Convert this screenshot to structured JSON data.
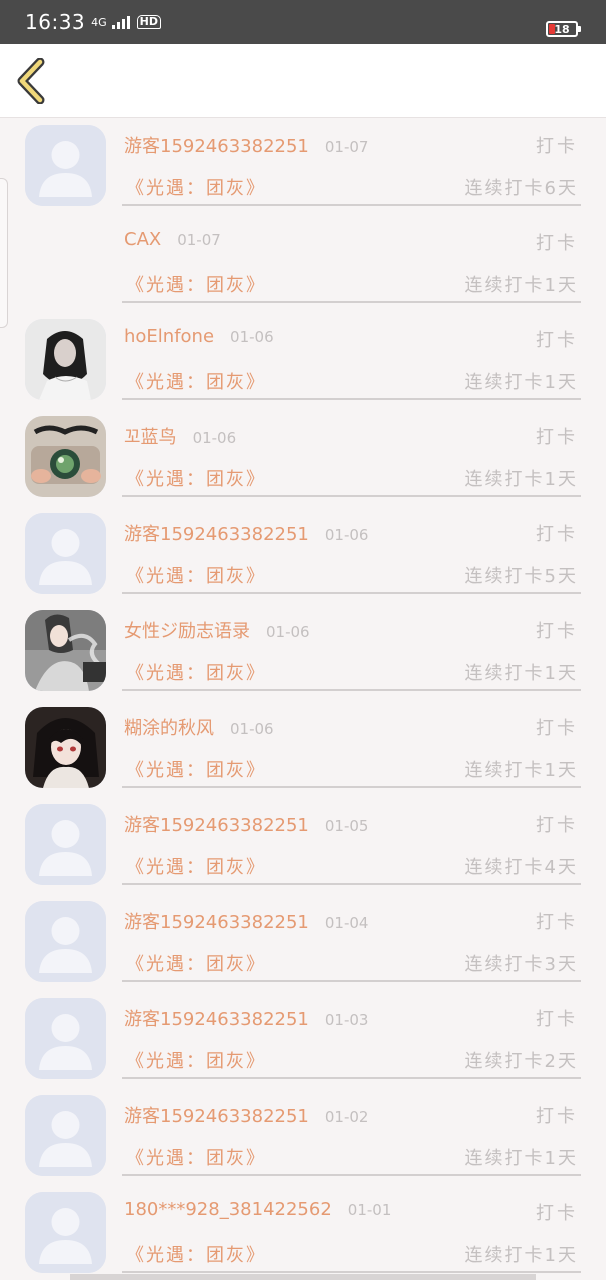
{
  "status_bar": {
    "time": "16:33",
    "network": "4G",
    "hd": "HD",
    "battery": "18"
  },
  "header": {
    "back_icon": "chevron-left-icon",
    "accent_color": "#f0d87a"
  },
  "colors": {
    "name": "#e59a72",
    "muted": "#c4c0c0",
    "divider": "#d3cfcf"
  },
  "entries": [
    {
      "name": "游客1592463382251",
      "date": "01-07",
      "action": "打卡",
      "title": "《光遇：团灰》",
      "streak": "连续打卡6天",
      "avatar": "default"
    },
    {
      "name": "CAX",
      "date": "01-07",
      "action": "打卡",
      "title": "《光遇：团灰》",
      "streak": "连续打卡1天",
      "avatar": "none"
    },
    {
      "name": "hoElnfone",
      "date": "01-06",
      "action": "打卡",
      "title": "《光遇：团灰》",
      "streak": "连续打卡1天",
      "avatar": "photo-girl"
    },
    {
      "name": "꼬蓝鸟",
      "date": "01-06",
      "action": "打卡",
      "title": "《光遇：团灰》",
      "streak": "连续打卡1天",
      "avatar": "photo-camera"
    },
    {
      "name": "游客1592463382251",
      "date": "01-06",
      "action": "打卡",
      "title": "《光遇：团灰》",
      "streak": "连续打卡5天",
      "avatar": "default"
    },
    {
      "name": "女性ジ励志语录",
      "date": "01-06",
      "action": "打卡",
      "title": "《光遇：团灰》",
      "streak": "连续打卡1天",
      "avatar": "photo-smoke"
    },
    {
      "name": "糊涂的秋风",
      "date": "01-06",
      "action": "打卡",
      "title": "《光遇：团灰》",
      "streak": "连续打卡1天",
      "avatar": "photo-anime"
    },
    {
      "name": "游客1592463382251",
      "date": "01-05",
      "action": "打卡",
      "title": "《光遇：团灰》",
      "streak": "连续打卡4天",
      "avatar": "default"
    },
    {
      "name": "游客1592463382251",
      "date": "01-04",
      "action": "打卡",
      "title": "《光遇：团灰》",
      "streak": "连续打卡3天",
      "avatar": "default"
    },
    {
      "name": "游客1592463382251",
      "date": "01-03",
      "action": "打卡",
      "title": "《光遇：团灰》",
      "streak": "连续打卡2天",
      "avatar": "default"
    },
    {
      "name": "游客1592463382251",
      "date": "01-02",
      "action": "打卡",
      "title": "《光遇：团灰》",
      "streak": "连续打卡1天",
      "avatar": "default"
    },
    {
      "name": "180***928_381422562",
      "date": "01-01",
      "action": "打卡",
      "title": "《光遇：团灰》",
      "streak": "连续打卡1天",
      "avatar": "default"
    }
  ]
}
